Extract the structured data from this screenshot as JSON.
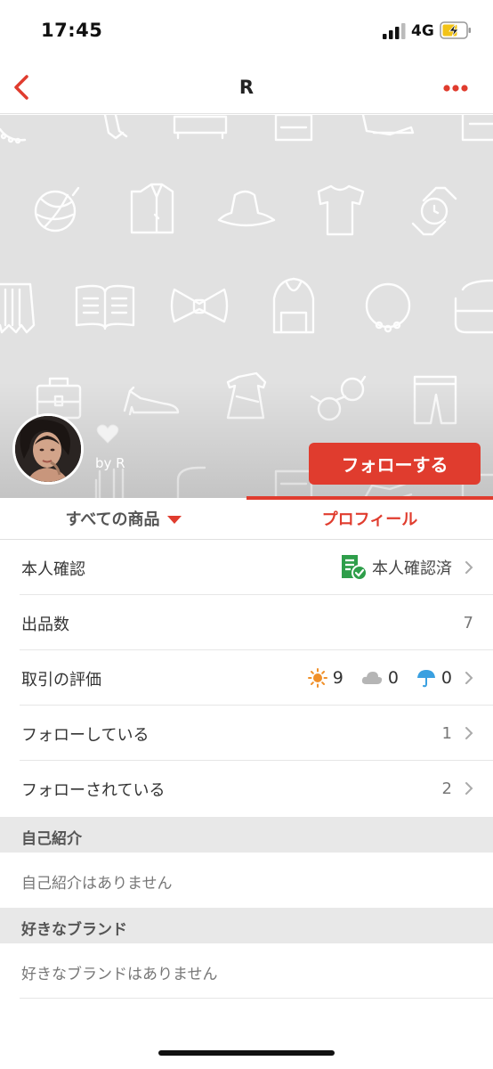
{
  "status_bar": {
    "time": "17:45",
    "network": "4G"
  },
  "nav": {
    "title": "R"
  },
  "profile": {
    "byline": "by R",
    "follow_label": "フォローする"
  },
  "tabs": [
    {
      "label": "すべての商品"
    },
    {
      "label": "プロフィール"
    }
  ],
  "rows": {
    "identity": {
      "label": "本人確認",
      "value": "本人確認済"
    },
    "listings": {
      "label": "出品数",
      "value": "7"
    },
    "ratings": {
      "label": "取引の評価",
      "good": "9",
      "normal": "0",
      "bad": "0"
    },
    "following": {
      "label": "フォローしている",
      "value": "1"
    },
    "followers": {
      "label": "フォローされている",
      "value": "2"
    }
  },
  "sections": {
    "intro": {
      "heading": "自己紹介",
      "body": "自己紹介はありません"
    },
    "brands": {
      "heading": "好きなブランド",
      "body": "好きなブランドはありません"
    }
  },
  "colors": {
    "accent": "#e03c2e",
    "verified": "#2e9e4a",
    "sun": "#f0902a",
    "cloud": "#b5b5b5",
    "umbrella": "#3aa0e0"
  },
  "icons": [
    "back-chevron-icon",
    "more-dots-icon",
    "heart-icon",
    "verified-document-icon",
    "sun-icon",
    "cloud-icon",
    "umbrella-icon",
    "chevron-right-icon"
  ]
}
